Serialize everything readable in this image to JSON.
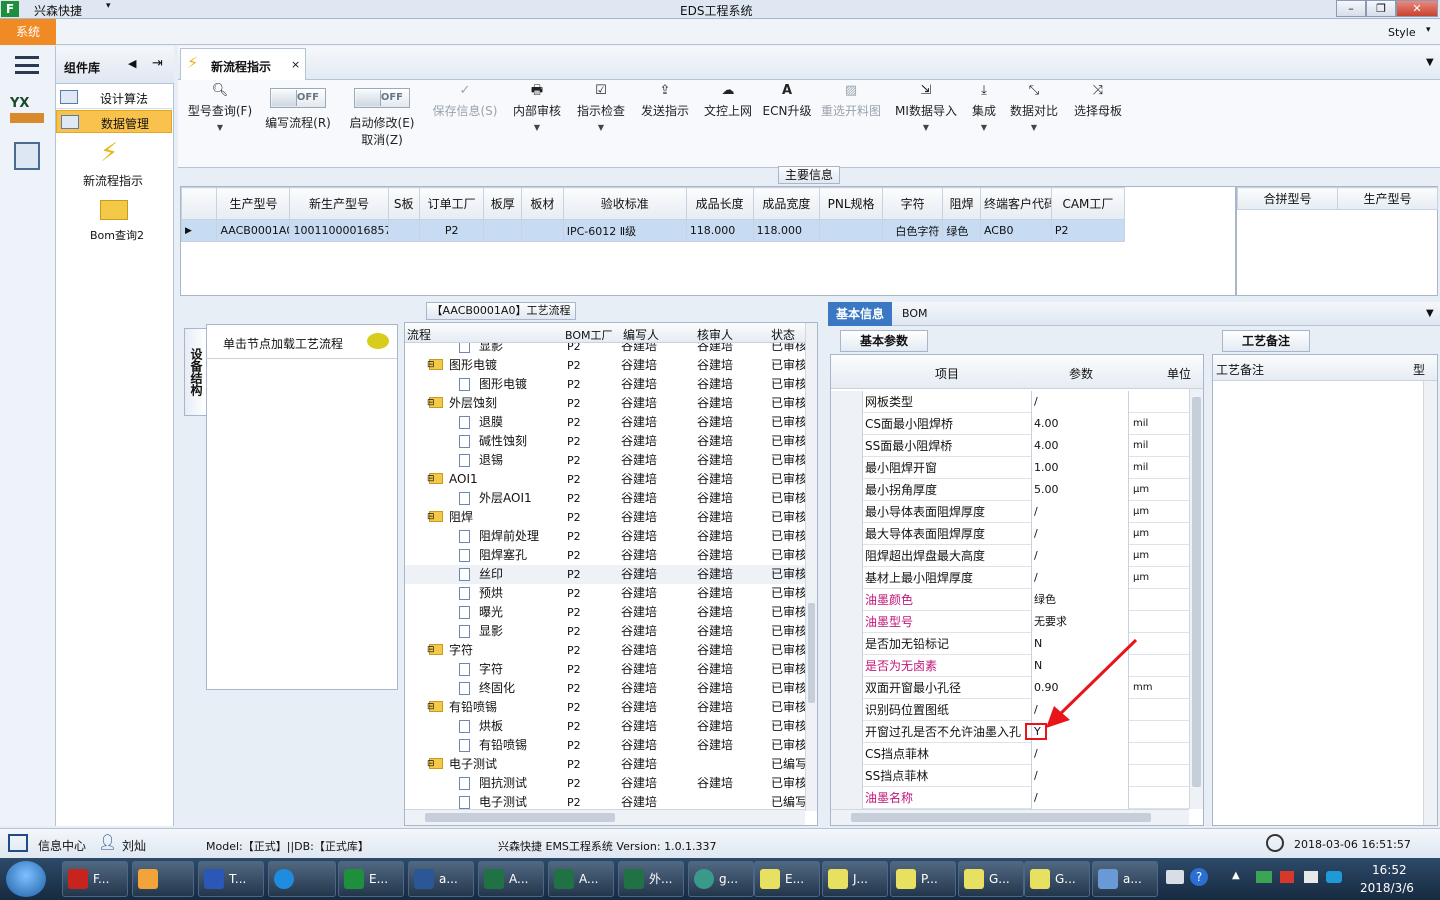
{
  "window": {
    "app_name": "兴森快捷",
    "title": "EDS工程系统",
    "style_label": "Style",
    "system_menu": "系统"
  },
  "component_bar": {
    "title": "组件库",
    "items": [
      {
        "label": "设计算法"
      },
      {
        "label": "数据管理"
      }
    ],
    "tools": [
      {
        "label": "新流程指示"
      },
      {
        "label": "Bom查询2"
      }
    ]
  },
  "tab": {
    "label": "新流程指示"
  },
  "toolbar": {
    "items": [
      {
        "label": "型号查询(F)",
        "icon": "search-icon"
      },
      {
        "label": "编写流程(R)",
        "toggle": "OFF"
      },
      {
        "label": "启动修改(E)",
        "label2": "取消(Z)",
        "toggle": "OFF"
      },
      {
        "label": "保存信息(S)",
        "icon": "check-icon"
      },
      {
        "label": "内部审核",
        "icon": "printer-icon"
      },
      {
        "label": "指示检查",
        "icon": "checkbox-icon"
      },
      {
        "label": "发送指示",
        "icon": "upload-icon"
      },
      {
        "label": "文控上网",
        "icon": "cloud-upload-icon"
      },
      {
        "label": "ECN升级",
        "icon": "font-a-icon"
      },
      {
        "label": "重选开料图",
        "icon": "image-icon"
      },
      {
        "label": "MI数据导入",
        "icon": "import-icon"
      },
      {
        "label": "集成",
        "icon": "download-icon"
      },
      {
        "label": "数据对比",
        "icon": "compare-icon"
      },
      {
        "label": "选择母板",
        "icon": "shuffle-icon"
      }
    ]
  },
  "main_info": {
    "title": "主要信息",
    "columns": [
      "生产型号",
      "新生产型号",
      "S板",
      "订单工厂",
      "板厚",
      "板材",
      "验收标准",
      "成品长度",
      "成品宽度",
      "PNL规格",
      "字符",
      "阻焊",
      "终端客户代码",
      "CAM工厂"
    ],
    "rows": [
      [
        "AACB0001A0",
        "10011000016857",
        "",
        "P2",
        "",
        "",
        "IPC-6012 Ⅱ级",
        "118.000",
        "118.000",
        "",
        "白色字符",
        "绿色",
        "ACB0",
        "P2"
      ]
    ],
    "side_columns": [
      "合拼型号",
      "生产型号"
    ]
  },
  "flow": {
    "title": "【AACB0001A0】工艺流程",
    "vertical_tab": "设备结构",
    "node_hint": "单击节点加载工艺流程",
    "columns": [
      "流程",
      "BOM工厂",
      "编写人",
      "核审人",
      "状态"
    ],
    "rows": [
      {
        "level": 2,
        "type": "doc",
        "name": "显影",
        "factory": "P2",
        "writer": "谷建培",
        "reviewer": "谷建培",
        "status": "已审核"
      },
      {
        "level": 1,
        "type": "folder",
        "name": "图形电镀",
        "factory": "P2",
        "writer": "谷建培",
        "reviewer": "谷建培",
        "status": "已审核"
      },
      {
        "level": 2,
        "type": "doc",
        "name": "图形电镀",
        "factory": "P2",
        "writer": "谷建培",
        "reviewer": "谷建培",
        "status": "已审核"
      },
      {
        "level": 1,
        "type": "folder",
        "name": "外层蚀刻",
        "factory": "P2",
        "writer": "谷建培",
        "reviewer": "谷建培",
        "status": "已审核"
      },
      {
        "level": 2,
        "type": "doc",
        "name": "退膜",
        "factory": "P2",
        "writer": "谷建培",
        "reviewer": "谷建培",
        "status": "已审核"
      },
      {
        "level": 2,
        "type": "doc",
        "name": "碱性蚀刻",
        "factory": "P2",
        "writer": "谷建培",
        "reviewer": "谷建培",
        "status": "已审核"
      },
      {
        "level": 2,
        "type": "doc",
        "name": "退锡",
        "factory": "P2",
        "writer": "谷建培",
        "reviewer": "谷建培",
        "status": "已审核"
      },
      {
        "level": 1,
        "type": "folder",
        "name": "AOI1",
        "factory": "P2",
        "writer": "谷建培",
        "reviewer": "谷建培",
        "status": "已审核"
      },
      {
        "level": 2,
        "type": "doc",
        "name": "外层AOI1",
        "factory": "P2",
        "writer": "谷建培",
        "reviewer": "谷建培",
        "status": "已审核"
      },
      {
        "level": 1,
        "type": "folder",
        "name": "阻焊",
        "factory": "P2",
        "writer": "谷建培",
        "reviewer": "谷建培",
        "status": "已审核"
      },
      {
        "level": 2,
        "type": "doc",
        "name": "阻焊前处理",
        "factory": "P2",
        "writer": "谷建培",
        "reviewer": "谷建培",
        "status": "已审核"
      },
      {
        "level": 2,
        "type": "doc",
        "name": "阻焊塞孔",
        "factory": "P2",
        "writer": "谷建培",
        "reviewer": "谷建培",
        "status": "已审核"
      },
      {
        "level": 2,
        "type": "doc",
        "name": "丝印",
        "factory": "P2",
        "writer": "谷建培",
        "reviewer": "谷建培",
        "status": "已审核"
      },
      {
        "level": 2,
        "type": "doc",
        "name": "预烘",
        "factory": "P2",
        "writer": "谷建培",
        "reviewer": "谷建培",
        "status": "已审核"
      },
      {
        "level": 2,
        "type": "doc",
        "name": "曝光",
        "factory": "P2",
        "writer": "谷建培",
        "reviewer": "谷建培",
        "status": "已审核"
      },
      {
        "level": 2,
        "type": "doc",
        "name": "显影",
        "factory": "P2",
        "writer": "谷建培",
        "reviewer": "谷建培",
        "status": "已审核"
      },
      {
        "level": 1,
        "type": "folder",
        "name": "字符",
        "factory": "P2",
        "writer": "谷建培",
        "reviewer": "谷建培",
        "status": "已审核"
      },
      {
        "level": 2,
        "type": "doc",
        "name": "字符",
        "factory": "P2",
        "writer": "谷建培",
        "reviewer": "谷建培",
        "status": "已审核"
      },
      {
        "level": 2,
        "type": "doc",
        "name": "终固化",
        "factory": "P2",
        "writer": "谷建培",
        "reviewer": "谷建培",
        "status": "已审核"
      },
      {
        "level": 1,
        "type": "folder",
        "name": "有铅喷锡",
        "factory": "P2",
        "writer": "谷建培",
        "reviewer": "谷建培",
        "status": "已审核"
      },
      {
        "level": 2,
        "type": "doc",
        "name": "烘板",
        "factory": "P2",
        "writer": "谷建培",
        "reviewer": "谷建培",
        "status": "已审核"
      },
      {
        "level": 2,
        "type": "doc",
        "name": "有铅喷锡",
        "factory": "P2",
        "writer": "谷建培",
        "reviewer": "谷建培",
        "status": "已审核"
      },
      {
        "level": 1,
        "type": "folder",
        "name": "电子测试",
        "factory": "P2",
        "writer": "谷建培",
        "reviewer": "",
        "status": "已编写"
      },
      {
        "level": 2,
        "type": "doc",
        "name": "阻抗测试",
        "factory": "P2",
        "writer": "谷建培",
        "reviewer": "谷建培",
        "status": "已审核"
      },
      {
        "level": 2,
        "type": "doc",
        "name": "电子测试",
        "factory": "P2",
        "writer": "谷建培",
        "reviewer": "",
        "status": "已编写"
      }
    ]
  },
  "basic_info": {
    "tabs": [
      "基本信息",
      "BOM"
    ],
    "subtab": "基本参数",
    "columns": [
      "项目",
      "参数",
      "单位"
    ],
    "rows": [
      {
        "item": "网板类型",
        "value": "/",
        "unit": "",
        "highlight": false
      },
      {
        "item": "CS面最小阻焊桥",
        "value": "4.00",
        "unit": "mil",
        "highlight": false
      },
      {
        "item": "SS面最小阻焊桥",
        "value": "4.00",
        "unit": "mil",
        "highlight": false
      },
      {
        "item": "最小阻焊开窗",
        "value": "1.00",
        "unit": "mil",
        "highlight": false
      },
      {
        "item": "最小拐角厚度",
        "value": "5.00",
        "unit": "μm",
        "highlight": false
      },
      {
        "item": "最小导体表面阻焊厚度",
        "value": "/",
        "unit": "μm",
        "highlight": false
      },
      {
        "item": "最大导体表面阻焊厚度",
        "value": "/",
        "unit": "μm",
        "highlight": false
      },
      {
        "item": "阻焊超出焊盘最大高度",
        "value": "/",
        "unit": "μm",
        "highlight": false
      },
      {
        "item": "基材上最小阻焊厚度",
        "value": "/",
        "unit": "μm",
        "highlight": false
      },
      {
        "item": "油墨颜色",
        "value": "绿色",
        "unit": "",
        "highlight": true
      },
      {
        "item": "油墨型号",
        "value": "无要求",
        "unit": "",
        "highlight": true
      },
      {
        "item": "是否加无铅标记",
        "value": "N",
        "unit": "",
        "highlight": false
      },
      {
        "item": "是否为无卤素",
        "value": "N",
        "unit": "",
        "highlight": true
      },
      {
        "item": "双面开窗最小孔径",
        "value": "0.90",
        "unit": "mm",
        "highlight": false
      },
      {
        "item": "识别码位置图纸",
        "value": "/",
        "unit": "",
        "highlight": false
      },
      {
        "item": "开窗过孔是否不允许油墨入孔",
        "value": "Y",
        "unit": "",
        "highlight": false
      },
      {
        "item": "CS挡点菲林",
        "value": "/",
        "unit": "",
        "highlight": false
      },
      {
        "item": "SS挡点菲林",
        "value": "/",
        "unit": "",
        "highlight": false
      },
      {
        "item": "油墨名称",
        "value": "/",
        "unit": "",
        "highlight": true
      }
    ]
  },
  "process_notes": {
    "tab": "工艺备注",
    "columns": [
      "工艺备注",
      "型"
    ]
  },
  "status_bar": {
    "info_center": "信息中心",
    "user": "刘灿",
    "model_db": "Model:【正式】||DB:【正式库】",
    "system_version": "兴森快捷 EMS工程系统 Version: 1.0.1.337",
    "datetime": "2018-03-06 16:51:57"
  },
  "taskbar": {
    "items": [
      {
        "label": "F..."
      },
      {
        "label": ""
      },
      {
        "label": "T..."
      },
      {
        "label": ""
      },
      {
        "label": "E..."
      },
      {
        "label": "a..."
      },
      {
        "label": "A..."
      },
      {
        "label": "A..."
      },
      {
        "label": "外..."
      },
      {
        "label": "g..."
      },
      {
        "label": "E..."
      },
      {
        "label": "J..."
      },
      {
        "label": "P..."
      },
      {
        "label": "G..."
      },
      {
        "label": "G..."
      },
      {
        "label": "a..."
      }
    ],
    "time": "16:52",
    "date": "2018/3/6"
  },
  "colors": {
    "accent_orange": "#f08a24",
    "selected_row": "#c7dcf3",
    "highlight_text": "#c0157a",
    "annotation_red": "#e8161b",
    "tab_blue": "#3a78c3"
  }
}
